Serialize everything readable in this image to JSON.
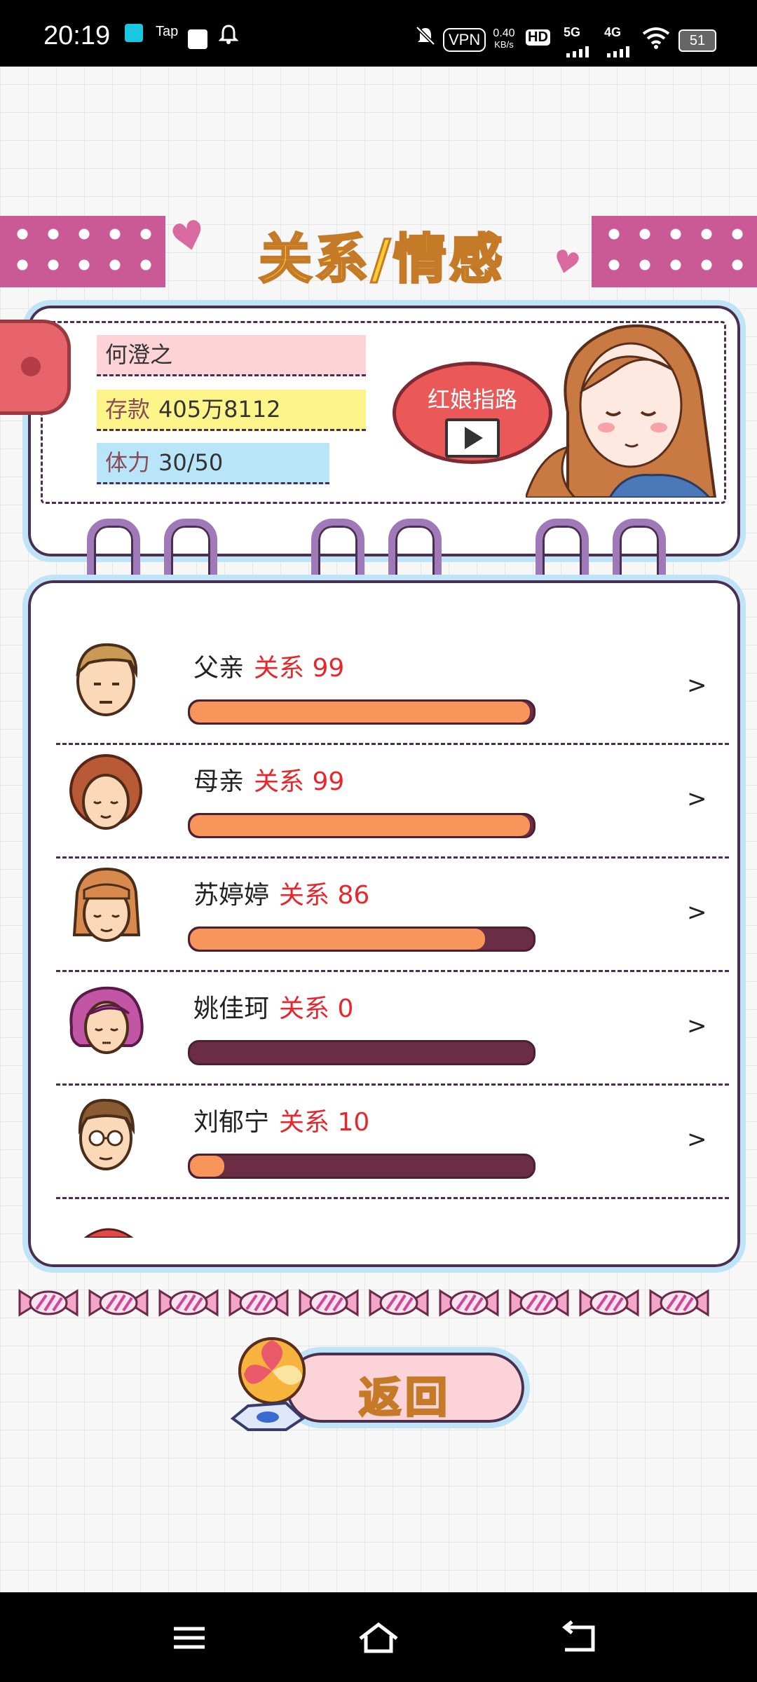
{
  "status_bar": {
    "time": "20:19",
    "tap": "Tap",
    "vpn": "VPN",
    "speed_value": "0.40",
    "speed_unit": "KB/s",
    "hd": "HD",
    "net1": "5G",
    "net2": "4G",
    "battery": "51"
  },
  "header": {
    "title": "关系/情感"
  },
  "profile": {
    "name": "何澄之",
    "savings_label": "存款",
    "savings_value": "405万8112",
    "stamina_label": "体力",
    "stamina_value": "30/50",
    "matchmaker_label": "红娘指路"
  },
  "relations": [
    {
      "name": "父亲",
      "rel_label": "关系",
      "value": "99",
      "level": 0.99
    },
    {
      "name": "母亲",
      "rel_label": "关系",
      "value": "99",
      "level": 0.99
    },
    {
      "name": "苏婷婷",
      "rel_label": "关系",
      "value": "86",
      "level": 0.86
    },
    {
      "name": "姚佳珂",
      "rel_label": "关系",
      "value": "0",
      "level": 0.0
    },
    {
      "name": "刘郁宁",
      "rel_label": "关系",
      "value": "10",
      "level": 0.1
    }
  ],
  "chevron": ">",
  "return_label": "返回",
  "colors": {
    "accent_pink": "#c95a96",
    "title_yellow": "#ffcc33",
    "bar_fill": "#f7955a",
    "bar_empty": "#6b2d44",
    "relation_red": "#e8262c",
    "card_border": "#bfe4f7"
  },
  "icons": [
    "bell-mute-icon",
    "wifi-icon",
    "signal-icon",
    "menu-icon",
    "home-icon",
    "back-icon",
    "heart-icon",
    "play-icon",
    "candy-icon",
    "lollipop-icon"
  ]
}
